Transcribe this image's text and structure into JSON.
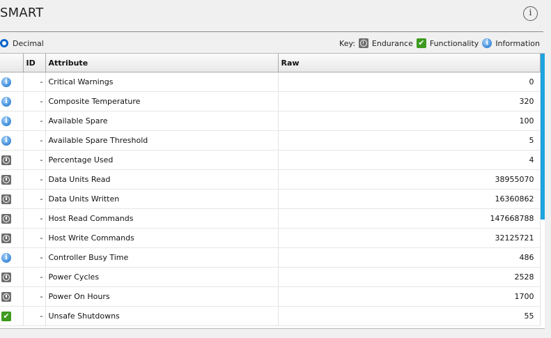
{
  "header": {
    "title": "SMART"
  },
  "display": {
    "mode_label": "Decimal"
  },
  "key": {
    "label": "Key:",
    "endurance": "Endurance",
    "functionality": "Functionality",
    "information": "Information"
  },
  "table": {
    "columns": [
      "ID",
      "Attribute",
      "Raw"
    ],
    "rows": [
      {
        "icon": "info-icon",
        "id": "-",
        "attribute": "Critical Warnings",
        "raw": "0"
      },
      {
        "icon": "info-icon",
        "id": "-",
        "attribute": "Composite Temperature",
        "raw": "320"
      },
      {
        "icon": "info-icon",
        "id": "-",
        "attribute": "Available Spare",
        "raw": "100"
      },
      {
        "icon": "info-icon",
        "id": "-",
        "attribute": "Available Spare Threshold",
        "raw": "5"
      },
      {
        "icon": "endurance-icon",
        "id": "-",
        "attribute": "Percentage Used",
        "raw": "4"
      },
      {
        "icon": "endurance-icon",
        "id": "-",
        "attribute": "Data Units Read",
        "raw": "38955070"
      },
      {
        "icon": "endurance-icon",
        "id": "-",
        "attribute": "Data Units Written",
        "raw": "16360862"
      },
      {
        "icon": "endurance-icon",
        "id": "-",
        "attribute": "Host Read Commands",
        "raw": "147668788"
      },
      {
        "icon": "endurance-icon",
        "id": "-",
        "attribute": "Host Write Commands",
        "raw": "32125721"
      },
      {
        "icon": "info-icon",
        "id": "-",
        "attribute": "Controller Busy Time",
        "raw": "486"
      },
      {
        "icon": "endurance-icon",
        "id": "-",
        "attribute": "Power Cycles",
        "raw": "2528"
      },
      {
        "icon": "endurance-icon",
        "id": "-",
        "attribute": "Power On Hours",
        "raw": "1700"
      },
      {
        "icon": "functionality-icon",
        "id": "-",
        "attribute": "Unsafe Shutdowns",
        "raw": "55"
      }
    ]
  },
  "colors": {
    "accent": "#0a64c8",
    "scrollbar": "#1ea5e0",
    "functionality_green": "#3e9a1e",
    "endurance_gray": "#6d6d6d"
  }
}
